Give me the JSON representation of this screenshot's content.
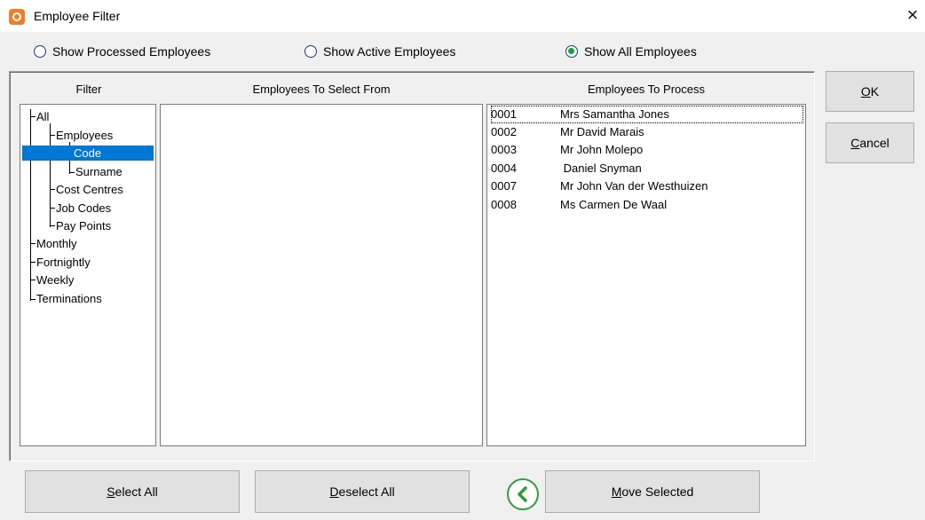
{
  "window": {
    "title": "Employee Filter",
    "close_glyph": "×"
  },
  "radios": [
    {
      "label": "Show Processed Employees",
      "checked": false
    },
    {
      "label": "Show Active Employees",
      "checked": false
    },
    {
      "label": "Show All Employees",
      "checked": true
    }
  ],
  "columns": {
    "filter": "Filter",
    "select_from": "Employees To Select From",
    "to_process": "Employees To Process"
  },
  "tree": [
    {
      "label": "All",
      "level": 0
    },
    {
      "label": "Employees",
      "level": 1
    },
    {
      "label": "Code",
      "level": 2,
      "selected": true
    },
    {
      "label": "Surname",
      "level": 2
    },
    {
      "label": "Cost Centres",
      "level": 1
    },
    {
      "label": "Job Codes",
      "level": 1
    },
    {
      "label": "Pay Points",
      "level": 1
    },
    {
      "label": "Monthly",
      "level": 0
    },
    {
      "label": "Fortnightly",
      "level": 0
    },
    {
      "label": "Weekly",
      "level": 0
    },
    {
      "label": "Terminations",
      "level": 0
    }
  ],
  "employees_to_process": [
    {
      "code": "0001",
      "name": "Mrs Samantha Jones"
    },
    {
      "code": "0002",
      "name": "Mr David Marais"
    },
    {
      "code": "0003",
      "name": "Mr John Molepo"
    },
    {
      "code": "0004",
      "name": " Daniel Snyman"
    },
    {
      "code": "0007",
      "name": "Mr John Van der Westhuizen"
    },
    {
      "code": "0008",
      "name": "Ms Carmen De Waal"
    }
  ],
  "buttons": {
    "ok": {
      "mnemonic": "O",
      "rest": "K"
    },
    "cancel": {
      "mnemonic": "C",
      "rest": "ancel"
    },
    "select_all": {
      "mnemonic": "S",
      "rest": "elect All"
    },
    "deselect_all": {
      "mnemonic": "D",
      "rest": "eselect All"
    },
    "move_selected": {
      "mnemonic": "M",
      "rest": "ove Selected"
    }
  },
  "colors": {
    "selection": "#0078d7",
    "accent_green": "#2f9e3a",
    "app_icon": "#f07d2a"
  },
  "icons": {
    "app": "app-logo-icon",
    "back": "arrow-left-circle-icon"
  }
}
